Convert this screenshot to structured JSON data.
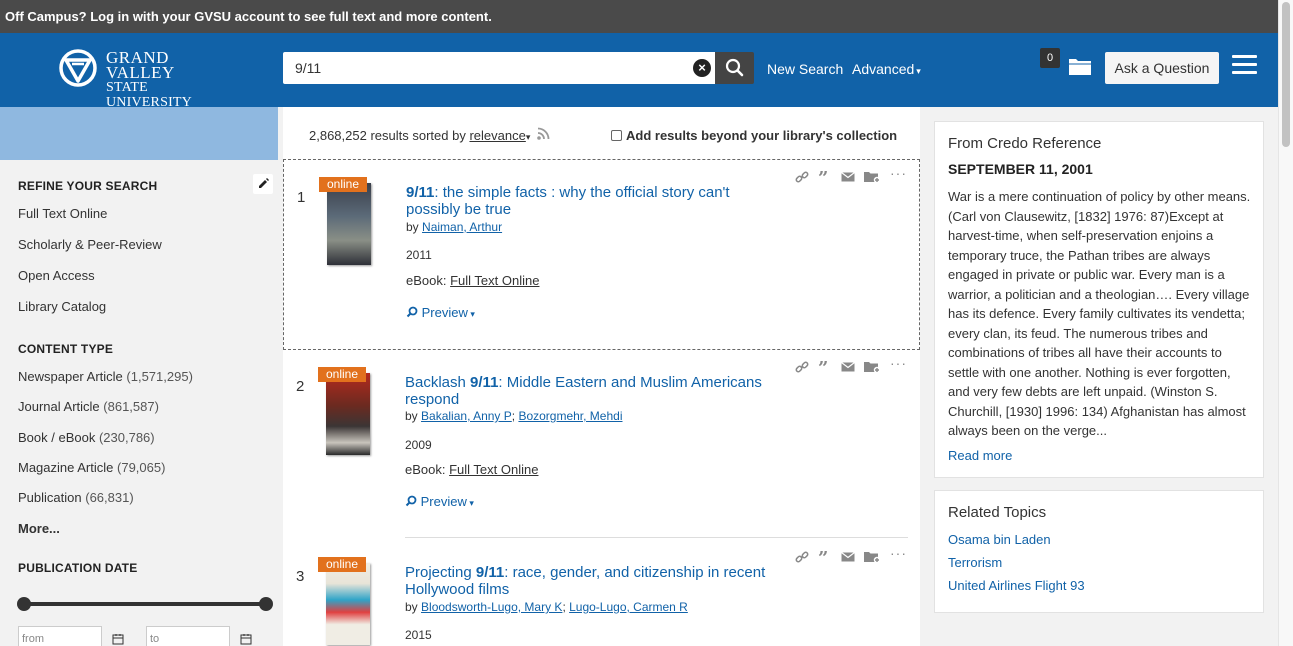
{
  "banner": {
    "text": "Off Campus? Log in with your GVSU account to see full text and more content."
  },
  "header": {
    "logo_line1": "GRAND VALLEY",
    "logo_line2": "STATE UNIVERSITY",
    "search_value": "9/11",
    "new_search": "New Search",
    "advanced": "Advanced",
    "basket_count": "0",
    "ask_question": "Ask a Question",
    "colors": {
      "bar": "#1162a8",
      "banner": "#4a4a4a"
    }
  },
  "sidebar": {
    "refine_heading": "REFINE YOUR SEARCH",
    "refine_items": [
      "Full Text Online",
      "Scholarly & Peer-Review",
      "Open Access",
      "Library Catalog"
    ],
    "content_heading": "CONTENT TYPE",
    "content_items": [
      {
        "label": "Newspaper Article",
        "count": "(1,571,295)"
      },
      {
        "label": "Journal Article",
        "count": "(861,587)"
      },
      {
        "label": "Book / eBook",
        "count": "(230,786)"
      },
      {
        "label": "Magazine Article",
        "count": "(79,065)"
      },
      {
        "label": "Publication",
        "count": "(66,831)"
      }
    ],
    "more": "More...",
    "pubdate_heading": "PUBLICATION DATE",
    "from_placeholder": "from",
    "to_placeholder": "to"
  },
  "results": {
    "count_text": "2,868,252 results sorted by",
    "sort": "relevance",
    "beyond": "Add results beyond your library's collection",
    "items": [
      {
        "num": "1",
        "badge": "online",
        "title_bold": "9/11",
        "title_rest": ": the simple facts : why the official story can't possibly be true",
        "by": "by",
        "authors": [
          "Naiman, Arthur"
        ],
        "year": "2011",
        "format": "eBook:",
        "fulltext": "Full Text Online",
        "preview": "Preview"
      },
      {
        "num": "2",
        "badge": "online",
        "title_pre": "Backlash ",
        "title_bold": "9/11",
        "title_rest": ": Middle Eastern and Muslim Americans respond",
        "by": "by",
        "authors": [
          "Bakalian, Anny P",
          "Bozorgmehr, Mehdi"
        ],
        "year": "2009",
        "format": "eBook:",
        "fulltext": "Full Text Online",
        "preview": "Preview"
      },
      {
        "num": "3",
        "badge": "online",
        "title_pre": "Projecting ",
        "title_bold": "9/11",
        "title_rest": ": race, gender, and citizenship in recent Hollywood films",
        "by": "by",
        "authors": [
          "Bloodsworth-Lugo, Mary K",
          "Lugo-Lugo, Carmen R"
        ],
        "year": "2015"
      }
    ]
  },
  "credo": {
    "title": "From Credo Reference",
    "subtitle": "SEPTEMBER 11, 2001",
    "text": "War is a mere continuation of policy by other means. (Carl von Clausewitz, [1832] 1976: 87)Except at harvest-time, when self-preservation enjoins a temporary truce, the Pathan tribes are always engaged in private or public war. Every man is a warrior, a politician and a theologian…. Every village has its defence. Every family cultivates its vendetta; every clan, its feud. The numerous tribes and combinations of tribes all have their accounts to settle with one another. Nothing is ever forgotten, and very few debts are left unpaid. (Winston S. Churchill, [1930] 1996: 134) Afghanistan has almost always been on the verge...",
    "read_more": "Read more"
  },
  "related": {
    "title": "Related Topics",
    "items": [
      "Osama bin Laden",
      "Terrorism",
      "United Airlines Flight 93"
    ]
  }
}
